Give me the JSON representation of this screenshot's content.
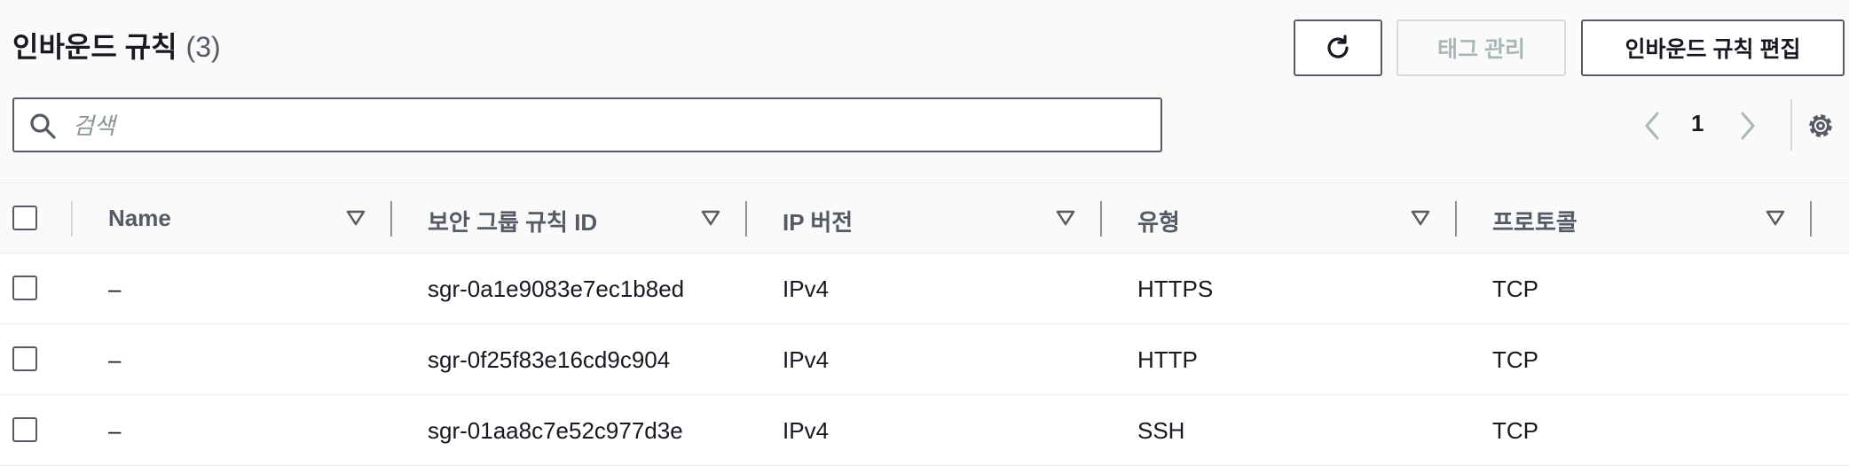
{
  "header": {
    "title": "인바운드 규칙",
    "count": "(3)",
    "buttons": {
      "refresh_icon": "refresh-icon",
      "manage_tags": "태그 관리",
      "edit_inbound_rules": "인바운드 규칙 편집"
    }
  },
  "search": {
    "placeholder": "검색",
    "value": ""
  },
  "pagination": {
    "current_page": "1"
  },
  "table": {
    "columns": [
      "Name",
      "보안 그룹 규칙 ID",
      "IP 버전",
      "유형",
      "프로토콜"
    ],
    "rows": [
      {
        "name": "–",
        "rule_id": "sgr-0a1e9083e7ec1b8ed",
        "ip_version": "IPv4",
        "type": "HTTPS",
        "protocol": "TCP"
      },
      {
        "name": "–",
        "rule_id": "sgr-0f25f83e16cd9c904",
        "ip_version": "IPv4",
        "type": "HTTP",
        "protocol": "TCP"
      },
      {
        "name": "–",
        "rule_id": "sgr-01aa8c7e52c977d3e",
        "ip_version": "IPv4",
        "type": "SSH",
        "protocol": "TCP"
      }
    ]
  },
  "colors": {
    "text": "#16191f",
    "muted": "#545b64",
    "disabled": "#aab7b8",
    "border": "#eaeded"
  }
}
